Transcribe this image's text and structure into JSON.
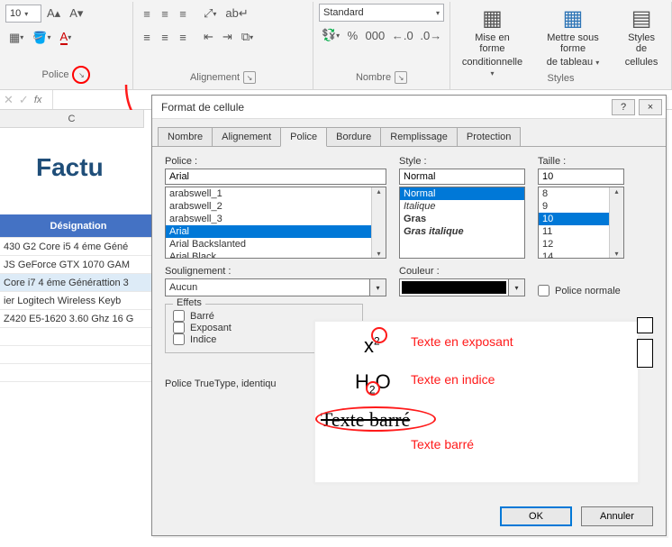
{
  "ribbon": {
    "font_size": "10",
    "number_format": "Standard",
    "group_police": "Police",
    "group_align": "Alignement",
    "group_number": "Nombre",
    "group_styles": "Styles",
    "cond_fmt_line1": "Mise en forme",
    "cond_fmt_line2": "conditionnelle",
    "table_line1": "Mettre sous forme",
    "table_line2": "de tableau",
    "cellstyles_line1": "Styles de",
    "cellstyles_line2": "cellules"
  },
  "formula_bar": {
    "fx": "fx"
  },
  "sheet": {
    "col_letter": "C",
    "factu_text": "Factu",
    "designation_header": "Désignation",
    "rows": [
      "430 G2 Core i5 4 éme Géné",
      "JS GeForce GTX 1070 GAM",
      "Core i7 4 éme Générattion 3",
      "ier Logitech Wireless Keyb",
      "Z420 E5-1620 3.60 Ghz 16 G"
    ]
  },
  "dialog": {
    "title": "Format de cellule",
    "help": "?",
    "close": "×",
    "tabs": [
      "Nombre",
      "Alignement",
      "Police",
      "Bordure",
      "Remplissage",
      "Protection"
    ],
    "active_tab": 2,
    "police_label": "Police :",
    "police_value": "Arial",
    "police_list": [
      "arabswell_1",
      "arabswell_2",
      "arabswell_3",
      "Arial",
      "Arial Backslanted",
      "Arial Black"
    ],
    "police_selected": 3,
    "style_label": "Style :",
    "style_value": "Normal",
    "style_list": [
      "Normal",
      "Italique",
      "Gras",
      "Gras italique"
    ],
    "style_selected": 0,
    "taille_label": "Taille :",
    "taille_value": "10",
    "taille_list": [
      "8",
      "9",
      "10",
      "11",
      "12",
      "14"
    ],
    "taille_selected": 2,
    "soulignement_label": "Soulignement :",
    "soulignement_value": "Aucun",
    "couleur_label": "Couleur :",
    "normal_font_label": "Police normale",
    "effets_label": "Effets",
    "effets": [
      "Barré",
      "Exposant",
      "Indice"
    ],
    "truetype_text": "Police TrueType, identiqu",
    "ok": "OK",
    "cancel": "Annuler"
  },
  "annot": {
    "x2": "x",
    "x2_sup": "2",
    "h2o_h": "H",
    "h2o_2": "2",
    "h2o_o": "O",
    "barre_txt": "Texte barré",
    "exposant_lbl": "Texte en exposant",
    "indice_lbl": "Texte en indice",
    "barre_lbl": "Texte barré"
  }
}
